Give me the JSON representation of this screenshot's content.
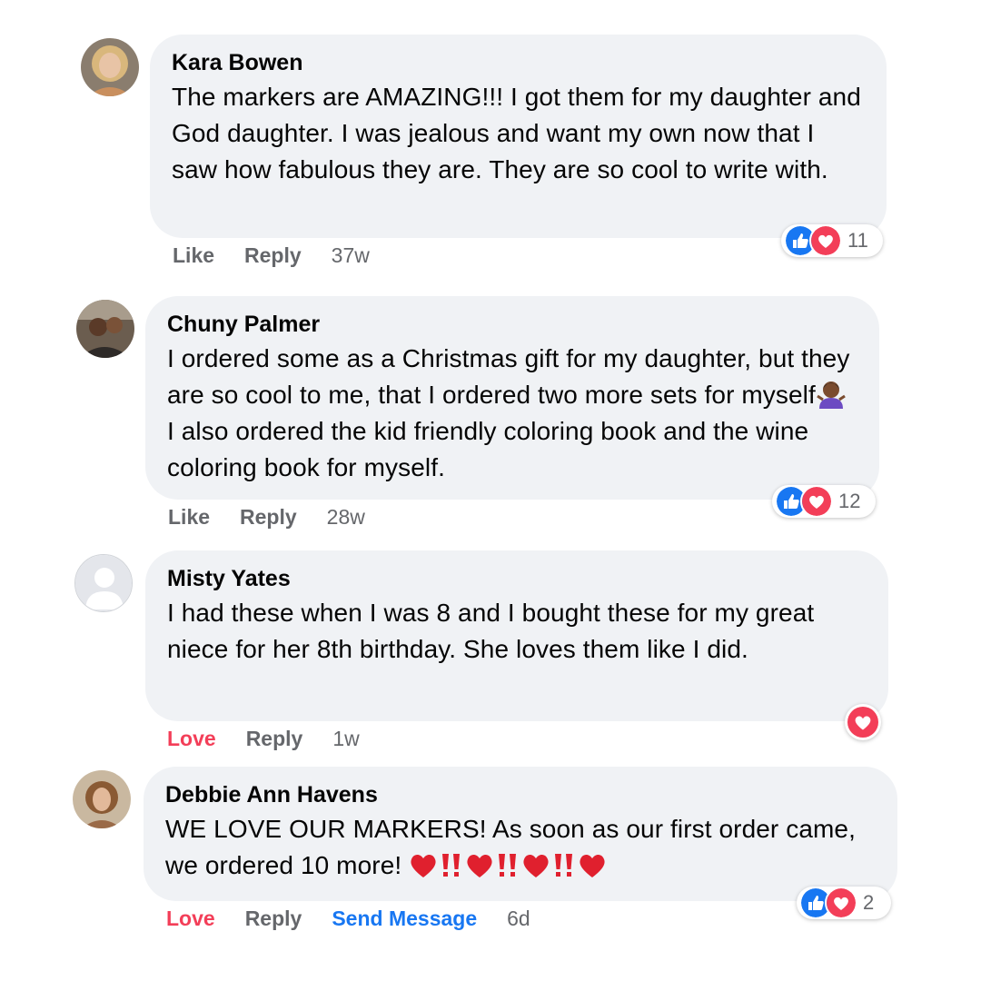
{
  "comments": [
    {
      "author": "Kara Bowen",
      "text": "The markers are AMAZING!!! I got them for my daughter and God daughter. I was jealous and want my own now that I saw how fabulous they are. They are so cool to write with.",
      "actions": {
        "react": "Like",
        "reply": "Reply",
        "time": "37w"
      },
      "reaction_count": "11"
    },
    {
      "author": "Chuny Palmer",
      "text_before_emoji": "I ordered some as a Christmas gift for my daughter, but they are so cool to me, that I ordered two more sets for myself",
      "text_after_emoji": " I also ordered the kid friendly coloring book and the wine coloring book for myself.",
      "emoji": "woman-shrugging-emoji",
      "actions": {
        "react": "Like",
        "reply": "Reply",
        "time": "28w"
      },
      "reaction_count": "12"
    },
    {
      "author": "Misty Yates",
      "text": "I had these when I was 8 and I bought these for my great niece for her 8th birthday. She loves them like I did.",
      "actions": {
        "react": "Love",
        "reply": "Reply",
        "time": "1w"
      }
    },
    {
      "author": "Debbie Ann Havens",
      "text": "WE LOVE OUR MARKERS! As soon as our first order came, we ordered 10 more! ",
      "emoji_sequence": [
        "red-heart",
        "double-exclamation",
        "red-heart",
        "double-exclamation",
        "red-heart",
        "double-exclamation",
        "red-heart"
      ],
      "actions": {
        "react": "Love",
        "reply": "Reply",
        "send_message": "Send Message",
        "time": "6d"
      },
      "reaction_count": "2"
    }
  ],
  "colors": {
    "bubble": "#f0f2f5",
    "like_blue": "#1877f2",
    "love_red": "#f33e58",
    "secondary_text": "#65676b"
  }
}
